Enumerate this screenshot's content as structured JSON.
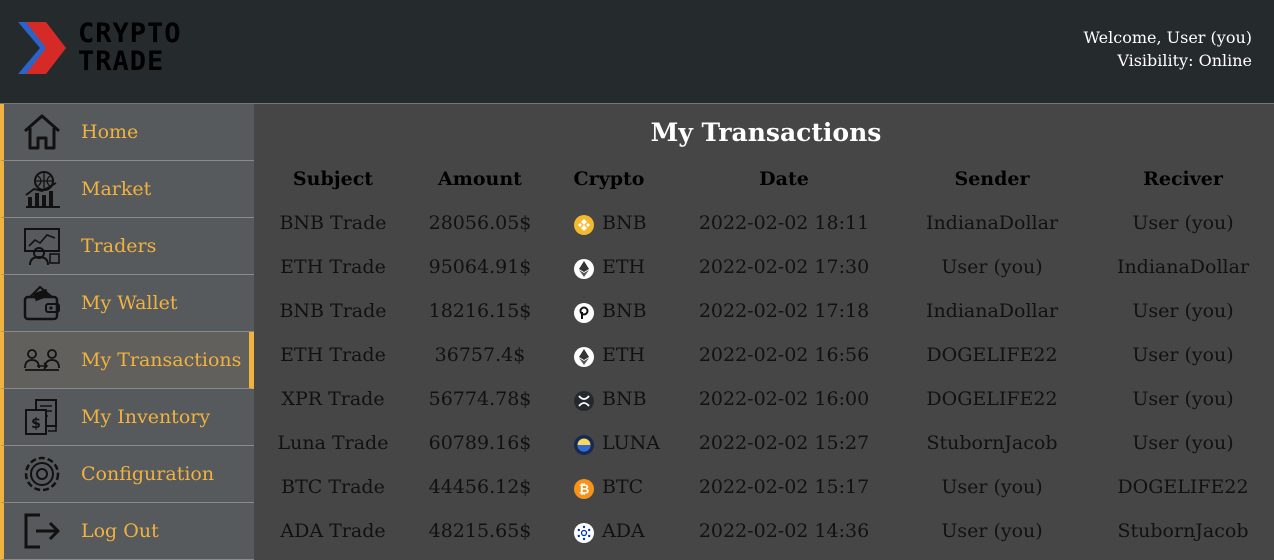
{
  "app": {
    "logo_line1": "CRYPTO",
    "logo_line2": "TRADE",
    "welcome_text": "Welcome, User (you)",
    "visibility_text": "Visibility: Online",
    "accent_color": "#f0b240"
  },
  "sidebar": {
    "items": [
      {
        "label": "Home",
        "icon": "home-icon"
      },
      {
        "label": "Market",
        "icon": "market-chart-icon"
      },
      {
        "label": "Traders",
        "icon": "traders-icon"
      },
      {
        "label": "My Wallet",
        "icon": "wallet-icon"
      },
      {
        "label": "My Transactions",
        "icon": "transactions-icon",
        "active": true
      },
      {
        "label": "My Inventory",
        "icon": "inventory-icon"
      },
      {
        "label": "Configuration",
        "icon": "gear-icon"
      },
      {
        "label": "Log Out",
        "icon": "logout-icon"
      }
    ]
  },
  "main": {
    "title": "My Transactions",
    "columns": [
      "Subject",
      "Amount",
      "Crypto",
      "Date",
      "Sender",
      "Reciver"
    ],
    "rows": [
      {
        "subject": "BNB Trade",
        "amount": "28056.05$",
        "crypto": "BNB",
        "coin_icon": "bnb-coin-icon",
        "date": "2022-02-02 18:11",
        "sender": "IndianaDollar",
        "receiver": "User (you)"
      },
      {
        "subject": "ETH Trade",
        "amount": "95064.91$",
        "crypto": "ETH",
        "coin_icon": "eth-coin-icon",
        "date": "2022-02-02 17:30",
        "sender": "User (you)",
        "receiver": "IndianaDollar"
      },
      {
        "subject": "BNB Trade",
        "amount": "18216.15$",
        "crypto": "BNB",
        "coin_icon": "polkadot-coin-icon",
        "date": "2022-02-02 17:18",
        "sender": "IndianaDollar",
        "receiver": "User (you)"
      },
      {
        "subject": "ETH Trade",
        "amount": "36757.4$",
        "crypto": "ETH",
        "coin_icon": "eth-coin-icon",
        "date": "2022-02-02 16:56",
        "sender": "DOGELIFE22",
        "receiver": "User (you)"
      },
      {
        "subject": "XPR Trade",
        "amount": "56774.78$",
        "crypto": "BNB",
        "coin_icon": "xrp-coin-icon",
        "date": "2022-02-02 16:00",
        "sender": "DOGELIFE22",
        "receiver": "User (you)"
      },
      {
        "subject": "Luna Trade",
        "amount": "60789.16$",
        "crypto": "LUNA",
        "coin_icon": "luna-coin-icon",
        "date": "2022-02-02 15:27",
        "sender": "StubornJacob",
        "receiver": "User (you)"
      },
      {
        "subject": "BTC Trade",
        "amount": "44456.12$",
        "crypto": "BTC",
        "coin_icon": "btc-coin-icon",
        "date": "2022-02-02 15:17",
        "sender": "User (you)",
        "receiver": "DOGELIFE22"
      },
      {
        "subject": "ADA Trade",
        "amount": "48215.65$",
        "crypto": "ADA",
        "coin_icon": "ada-coin-icon",
        "date": "2022-02-02 14:36",
        "sender": "User (you)",
        "receiver": "StubornJacob"
      }
    ]
  }
}
